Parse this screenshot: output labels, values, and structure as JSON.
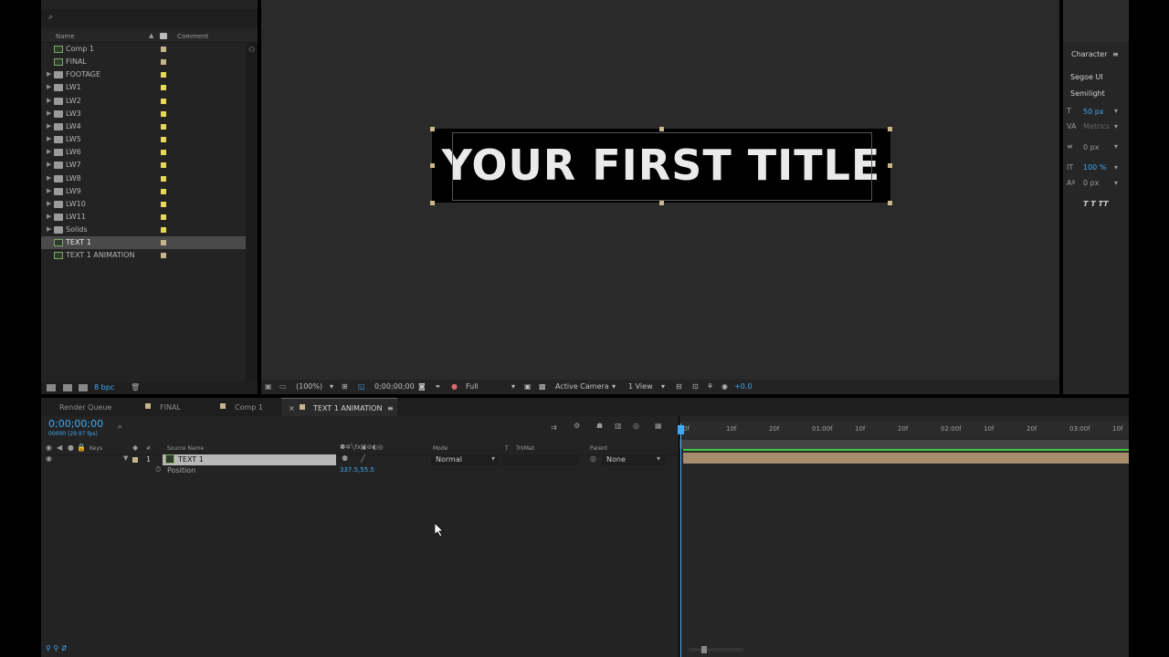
{
  "project": {
    "search_placeholder": "⌕",
    "col_name": "Name",
    "col_comment": "Comment",
    "bpc": "8 bpc",
    "items": [
      {
        "label": "Comp 1",
        "kind": "comp",
        "swatch": "#c8b48a",
        "expand": false
      },
      {
        "label": "FINAL",
        "kind": "comp",
        "swatch": "#c8b48a",
        "expand": false
      },
      {
        "label": "FOOTAGE",
        "kind": "folder",
        "swatch": "#e6d85a",
        "expand": true
      },
      {
        "label": "LW1",
        "kind": "folder",
        "swatch": "#e6d85a",
        "expand": true
      },
      {
        "label": "LW2",
        "kind": "folder",
        "swatch": "#e6d85a",
        "expand": true
      },
      {
        "label": "LW3",
        "kind": "folder",
        "swatch": "#e6d85a",
        "expand": true
      },
      {
        "label": "LW4",
        "kind": "folder",
        "swatch": "#e6d85a",
        "expand": true
      },
      {
        "label": "LW5",
        "kind": "folder",
        "swatch": "#e6d85a",
        "expand": true
      },
      {
        "label": "LW6",
        "kind": "folder",
        "swatch": "#e6d85a",
        "expand": true
      },
      {
        "label": "LW7",
        "kind": "folder",
        "swatch": "#e6d85a",
        "expand": true
      },
      {
        "label": "LW8",
        "kind": "folder",
        "swatch": "#e6d85a",
        "expand": true
      },
      {
        "label": "LW9",
        "kind": "folder",
        "swatch": "#e6d85a",
        "expand": true
      },
      {
        "label": "LW10",
        "kind": "folder",
        "swatch": "#e6d85a",
        "expand": true
      },
      {
        "label": "LW11",
        "kind": "folder",
        "swatch": "#e6d85a",
        "expand": true
      },
      {
        "label": "Solids",
        "kind": "folder",
        "swatch": "#e6d85a",
        "expand": true
      },
      {
        "label": "TEXT 1",
        "kind": "comp",
        "swatch": "#c8b48a",
        "expand": false,
        "selected": true
      },
      {
        "label": "TEXT 1 ANIMATION",
        "kind": "comp",
        "swatch": "#c8b48a",
        "expand": false
      }
    ]
  },
  "viewer": {
    "title_text": "YOUR FIRST TITLE",
    "zoom": "(100%)",
    "timecode": "0;00;00;00",
    "resolution": "Full",
    "camera": "Active Camera",
    "views": "1 View",
    "exposure": "+0.0"
  },
  "character": {
    "title": "Character",
    "font": "Segoe UI",
    "style": "Semilight",
    "size": "50 px",
    "kerning": "Metrics",
    "stroke": "0 px",
    "vscale": "100 %",
    "baseline": "0 px",
    "faux": "T T TT"
  },
  "tabs": [
    {
      "label": "Render Queue",
      "swatch": false,
      "active": false
    },
    {
      "label": "FINAL",
      "swatch": true,
      "active": false
    },
    {
      "label": "Comp 1",
      "swatch": true,
      "active": false
    },
    {
      "label": "TEXT 1 ANIMATION",
      "swatch": true,
      "active": true
    }
  ],
  "timeline": {
    "timecode": "0;00;00;00",
    "fps": "00000 (29.97 fps)",
    "col_keys": "Keys",
    "col_num": "#",
    "col_source": "Source Name",
    "col_mode": "Mode",
    "col_t": "T",
    "col_trkmat": "TrkMat",
    "col_parent": "Parent",
    "layer": {
      "num": "1",
      "name": "TEXT 1",
      "mode": "Normal",
      "parent": "None"
    },
    "property": {
      "name": "Position",
      "value": "337.5,55.5"
    },
    "ruler_ticks": [
      "0f",
      "10f",
      "20f",
      "01:00f",
      "10f",
      "20f",
      "02:00f",
      "10f",
      "20f",
      "03:00f",
      "10f"
    ]
  },
  "colors": {
    "accent": "#3fa9f5",
    "layer_bar": "#a68b6c",
    "green_line": "#3ec93e",
    "selection": "#c8b98a"
  }
}
